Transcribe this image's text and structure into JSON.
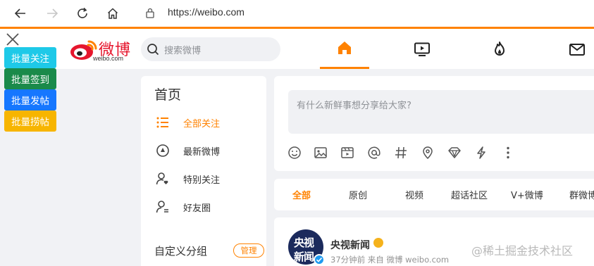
{
  "browser": {
    "url": "https://weibo.com"
  },
  "header": {
    "logo_text": "微博",
    "logo_sub": "weibo.com",
    "search_placeholder": "搜索微博"
  },
  "overlay": {
    "buttons": [
      {
        "label": "批量关注",
        "color": "#1ec9e8"
      },
      {
        "label": "批量签到",
        "color": "#1a8a4a"
      },
      {
        "label": "批量发帖",
        "color": "#1677ff"
      },
      {
        "label": "批量捞帖",
        "color": "#f7b500"
      }
    ]
  },
  "left": {
    "title": "首页",
    "items": [
      {
        "label": "全部关注",
        "icon": "list-icon",
        "active": true
      },
      {
        "label": "最新微博",
        "icon": "clock-icon",
        "active": false
      },
      {
        "label": "特别关注",
        "icon": "user-heart-icon",
        "active": false
      },
      {
        "label": "好友圈",
        "icon": "user-group-icon",
        "active": false
      }
    ],
    "group_title": "自定义分组",
    "manage_label": "管理"
  },
  "composer": {
    "placeholder": "有什么新鲜事想分享给大家?"
  },
  "tabs": [
    "全部",
    "原创",
    "视频",
    "超话社区",
    "V+微博",
    "群微博"
  ],
  "feed": {
    "avatar_line1": "央视",
    "avatar_line2": "新闻",
    "name": "央视新闻",
    "meta": "37分钟前  来自 微博 weibo.com"
  },
  "watermark": "@稀土掘金技术社区",
  "colors": {
    "accent": "#ff8200",
    "brand_red": "#e6162d"
  }
}
